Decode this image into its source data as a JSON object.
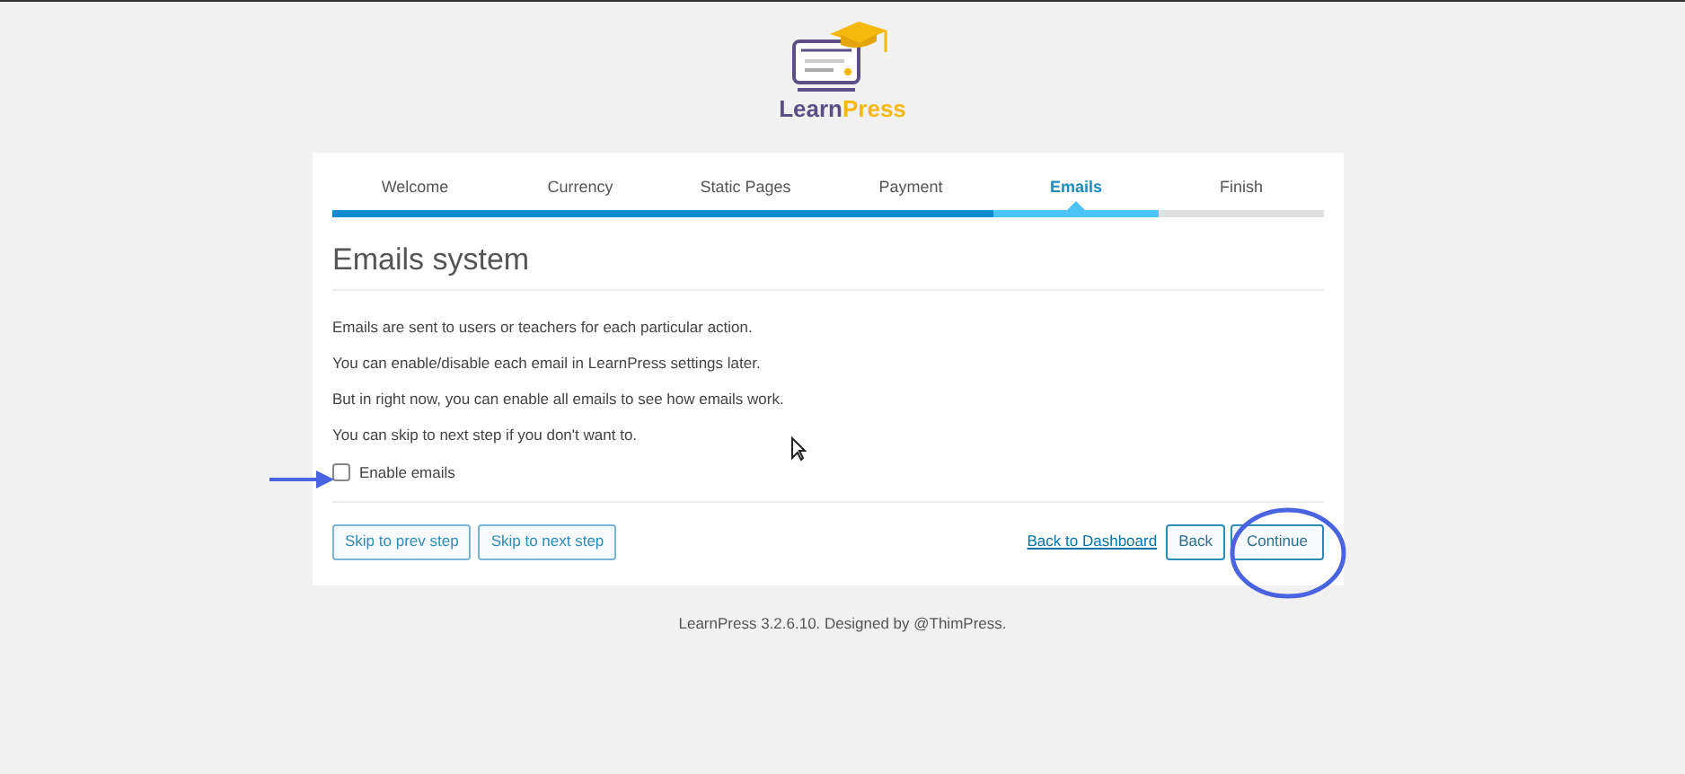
{
  "logo": {
    "wordmark": [
      "Learn",
      "Press"
    ]
  },
  "steps": [
    {
      "label": "Welcome",
      "selected": false,
      "done": true
    },
    {
      "label": "Currency",
      "selected": false,
      "done": true
    },
    {
      "label": "Static Pages",
      "selected": false,
      "done": true
    },
    {
      "label": "Payment",
      "selected": false,
      "done": true
    },
    {
      "label": "Emails",
      "selected": true,
      "done": false
    },
    {
      "label": "Finish",
      "selected": false,
      "done": false
    }
  ],
  "title": "Emails system",
  "paragraphs": [
    "Emails are sent to users or teachers for each particular action.",
    "You can enable/disable each email in LearnPress settings later.",
    "But in right now, you can enable all emails to see how emails work.",
    "You can skip to next step if you don't want to."
  ],
  "checkbox": {
    "label": "Enable emails",
    "checked": false
  },
  "left_buttons": [
    "Skip to prev step",
    "Skip to next step"
  ],
  "dashboard_link": "Back to Dashboard",
  "back_button": "Back",
  "continue_button": "Continue",
  "footer": "LearnPress 3.2.6.10. Designed by @ThimPress."
}
